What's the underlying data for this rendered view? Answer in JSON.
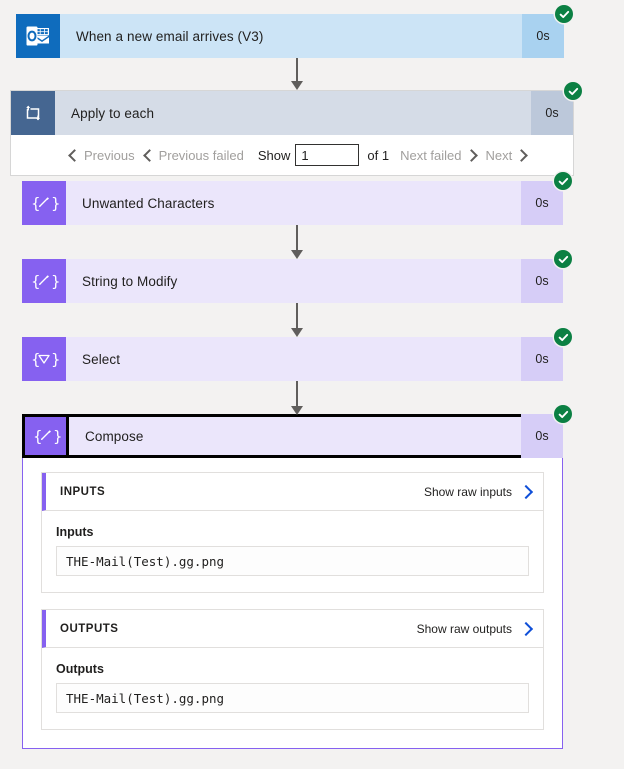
{
  "trigger": {
    "name": "When a new email arrives (V3)",
    "duration": "0s",
    "icon": "outlook-icon",
    "status": "succeeded"
  },
  "loop": {
    "name": "Apply to each",
    "duration": "0s",
    "icon": "loop-icon",
    "status": "succeeded",
    "pagination": {
      "previous": "Previous",
      "previous_failed": "Previous failed",
      "show_label": "Show",
      "page_value": "1",
      "total_label": "of 1",
      "next_failed": "Next failed",
      "next": "Next"
    }
  },
  "actions": [
    {
      "name": "Unwanted Characters",
      "duration": "0s",
      "icon": "compose-pencil-icon",
      "status": "succeeded",
      "selected": false
    },
    {
      "name": "String to Modify",
      "duration": "0s",
      "icon": "compose-pencil-icon",
      "status": "succeeded",
      "selected": false
    },
    {
      "name": "Select",
      "duration": "0s",
      "icon": "select-funnel-icon",
      "status": "succeeded",
      "selected": false
    },
    {
      "name": "Compose",
      "duration": "0s",
      "icon": "compose-pencil-icon",
      "status": "succeeded",
      "selected": true
    }
  ],
  "details": {
    "inputs": {
      "section_title": "INPUTS",
      "raw_link": "Show raw inputs",
      "field_label": "Inputs",
      "field_value": "THE-Mail(Test).gg.png"
    },
    "outputs": {
      "section_title": "OUTPUTS",
      "raw_link": "Show raw outputs",
      "field_label": "Outputs",
      "field_value": "THE-Mail(Test).gg.png"
    }
  },
  "colors": {
    "trigger_blue": "#0f6cbd",
    "action_purple": "#8661f0",
    "loop_slate": "#456691",
    "success_green": "#0b8043",
    "link_blue": "#0f4fd8"
  }
}
